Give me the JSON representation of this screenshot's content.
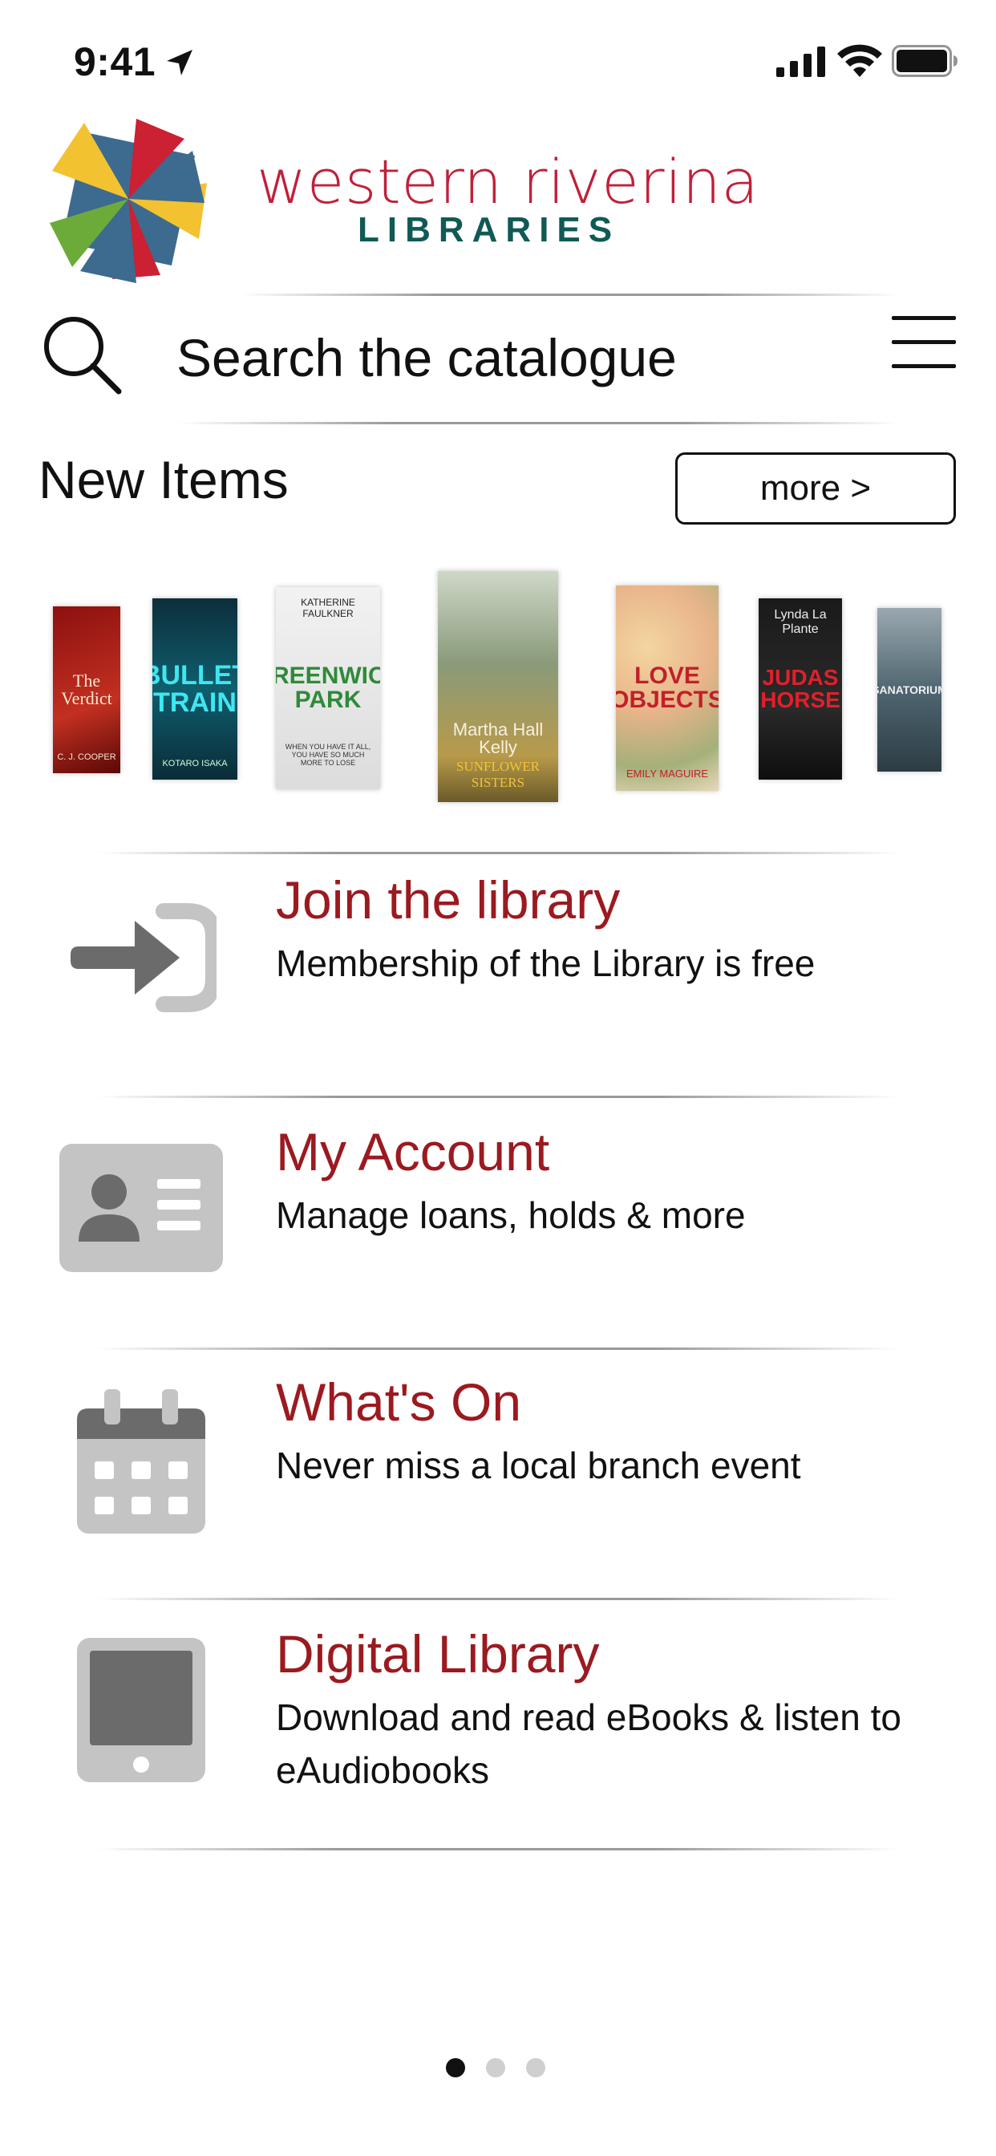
{
  "status_bar": {
    "time": "9:41",
    "icons": [
      "location-arrow-icon",
      "cellular-signal-icon",
      "wifi-icon",
      "battery-icon"
    ]
  },
  "header": {
    "logo_name": "western riverina",
    "logo_subtitle": "LIBRARIES",
    "colors": {
      "name": "#c0203a",
      "subtitle": "#0f5a55"
    }
  },
  "search": {
    "placeholder": "Search the catalogue",
    "icon": "search-icon",
    "menu_icon": "hamburger-menu-icon"
  },
  "new_items": {
    "title": "New Items",
    "more_label": "more >",
    "books": [
      {
        "title": "The Verdict",
        "author": "C. J. COOPER"
      },
      {
        "title": "BULLET TRAIN",
        "author": "KOTARO ISAKA"
      },
      {
        "title": "GREENWICH PARK",
        "author": "KATHERINE FAULKNER",
        "tagline": "WHEN YOU HAVE IT ALL, YOU HAVE SO MUCH MORE TO LOSE"
      },
      {
        "title": "SUNFLOWER SISTERS",
        "author": "Martha Hall Kelly"
      },
      {
        "title": "LOVE OBJECTS",
        "author": "EMILY MAGUIRE"
      },
      {
        "title": "JUDAS HORSE",
        "author": "Lynda La Plante"
      },
      {
        "title": "SANATORIUM",
        "author": ""
      }
    ]
  },
  "menu_items": [
    {
      "title": "Join the library",
      "description": "Membership of the Library is free",
      "icon": "sign-in-icon"
    },
    {
      "title": "My Account",
      "description": "Manage loans, holds & more",
      "icon": "id-card-icon"
    },
    {
      "title": "What's On",
      "description": "Never miss a local branch event",
      "icon": "calendar-icon"
    },
    {
      "title": "Digital Library",
      "description": "Download and read eBooks & listen to eAudiobooks",
      "icon": "tablet-icon"
    }
  ],
  "pagination": {
    "total": 3,
    "current": 1
  },
  "accent_color": "#9b1a20"
}
